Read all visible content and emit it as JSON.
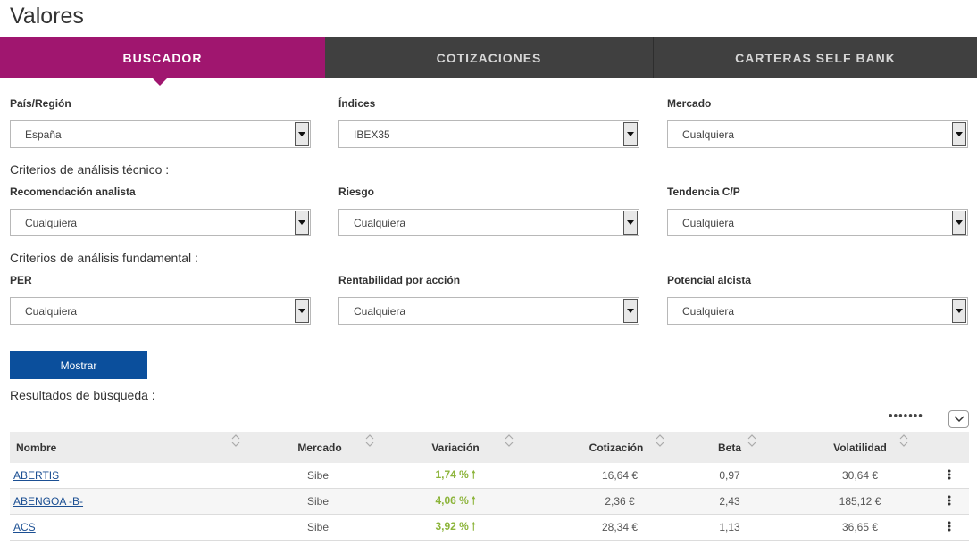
{
  "page": {
    "title": "Valores"
  },
  "tabs": [
    {
      "label": "BUSCADOR",
      "active": true
    },
    {
      "label": "COTIZACIONES",
      "active": false
    },
    {
      "label": "CARTERAS SELF BANK",
      "active": false
    }
  ],
  "filters": {
    "row1": [
      {
        "label": "País/Región",
        "value": "España"
      },
      {
        "label": "Índices",
        "value": "IBEX35"
      },
      {
        "label": "Mercado",
        "value": "Cualquiera"
      }
    ],
    "tecnico_title": "Criterios de análisis técnico :",
    "row2": [
      {
        "label": "Recomendación analista",
        "value": "Cualquiera"
      },
      {
        "label": "Riesgo",
        "value": "Cualquiera"
      },
      {
        "label": "Tendencia C/P",
        "value": "Cualquiera"
      }
    ],
    "fundamental_title": "Criterios de análisis fundamental :",
    "row3": [
      {
        "label": "PER",
        "value": "Cualquiera"
      },
      {
        "label": "Rentabilidad por acción",
        "value": "Cualquiera"
      },
      {
        "label": "Potencial alcista",
        "value": "Cualquiera"
      }
    ]
  },
  "show_button": "Mostrar",
  "results": {
    "title": "Resultados de búsqueda :",
    "dots": "•••••••",
    "headers": [
      "Nombre",
      "Mercado",
      "Variación",
      "Cotización",
      "Beta",
      "Volatilidad"
    ],
    "rows": [
      {
        "nombre": "ABERTIS",
        "mercado": "Sibe",
        "variacion": "1,74 %",
        "cotizacion": "16,64 €",
        "beta": "0,97",
        "volatilidad": "30,64 €"
      },
      {
        "nombre": "ABENGOA -B-",
        "mercado": "Sibe",
        "variacion": "4,06 %",
        "cotizacion": "2,36 €",
        "beta": "2,43",
        "volatilidad": "185,12 €"
      },
      {
        "nombre": "ACS",
        "mercado": "Sibe",
        "variacion": "3,92 %",
        "cotizacion": "28,34 €",
        "beta": "1,13",
        "volatilidad": "36,65 €"
      }
    ]
  },
  "colors": {
    "accent": "#a0166f",
    "tab_bar": "#404040",
    "button": "#0b4f9c",
    "positive": "#8cb43a",
    "link": "#1b4f93"
  },
  "icons": {
    "sort": "sort-updown-icon",
    "trend": "arrow-up-icon",
    "menu": "kebab-menu-icon",
    "expand": "chevron-down-icon",
    "dropdown": "dropdown-arrow-icon"
  }
}
